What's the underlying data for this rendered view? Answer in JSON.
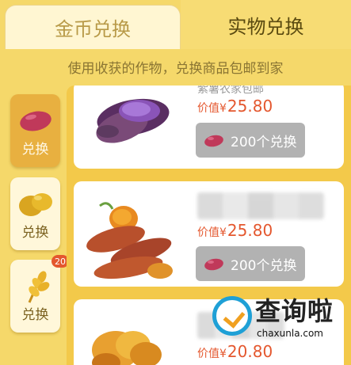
{
  "tabs": [
    {
      "label": "金币兑换",
      "active": false
    },
    {
      "label": "实物兑换",
      "active": true
    }
  ],
  "subtitle": "使用收获的作物，兑换商品包邮到家",
  "sidebar": {
    "items": [
      {
        "icon": "sweet-potato-icon",
        "label": "兑换",
        "active": true,
        "badge": ""
      },
      {
        "icon": "potato-icon",
        "label": "兑换",
        "active": false,
        "badge": ""
      },
      {
        "icon": "wheat-icon",
        "label": "兑换",
        "active": false,
        "badge": "20"
      }
    ]
  },
  "products": [
    {
      "image": "purple-sweet-potato-image",
      "name": "紫薯农家包邮",
      "price_prefix": "价值¥",
      "price": "25.80",
      "redeem_label": "200个兑换"
    },
    {
      "image": "sweet-potato-image",
      "name": "",
      "price_prefix": "价值¥",
      "price": "25.80",
      "redeem_label": "200个兑换"
    },
    {
      "image": "sweet-potato-chips-image",
      "name": "",
      "price_prefix": "价值¥",
      "price": "20.80",
      "redeem_label": ""
    }
  ],
  "watermark": {
    "title": "查询啦",
    "url": "chaxunla.com"
  },
  "colors": {
    "background": "#f5d86a",
    "accent": "#e8b040",
    "price": "#e4572e",
    "button": "#b2b2b2"
  }
}
